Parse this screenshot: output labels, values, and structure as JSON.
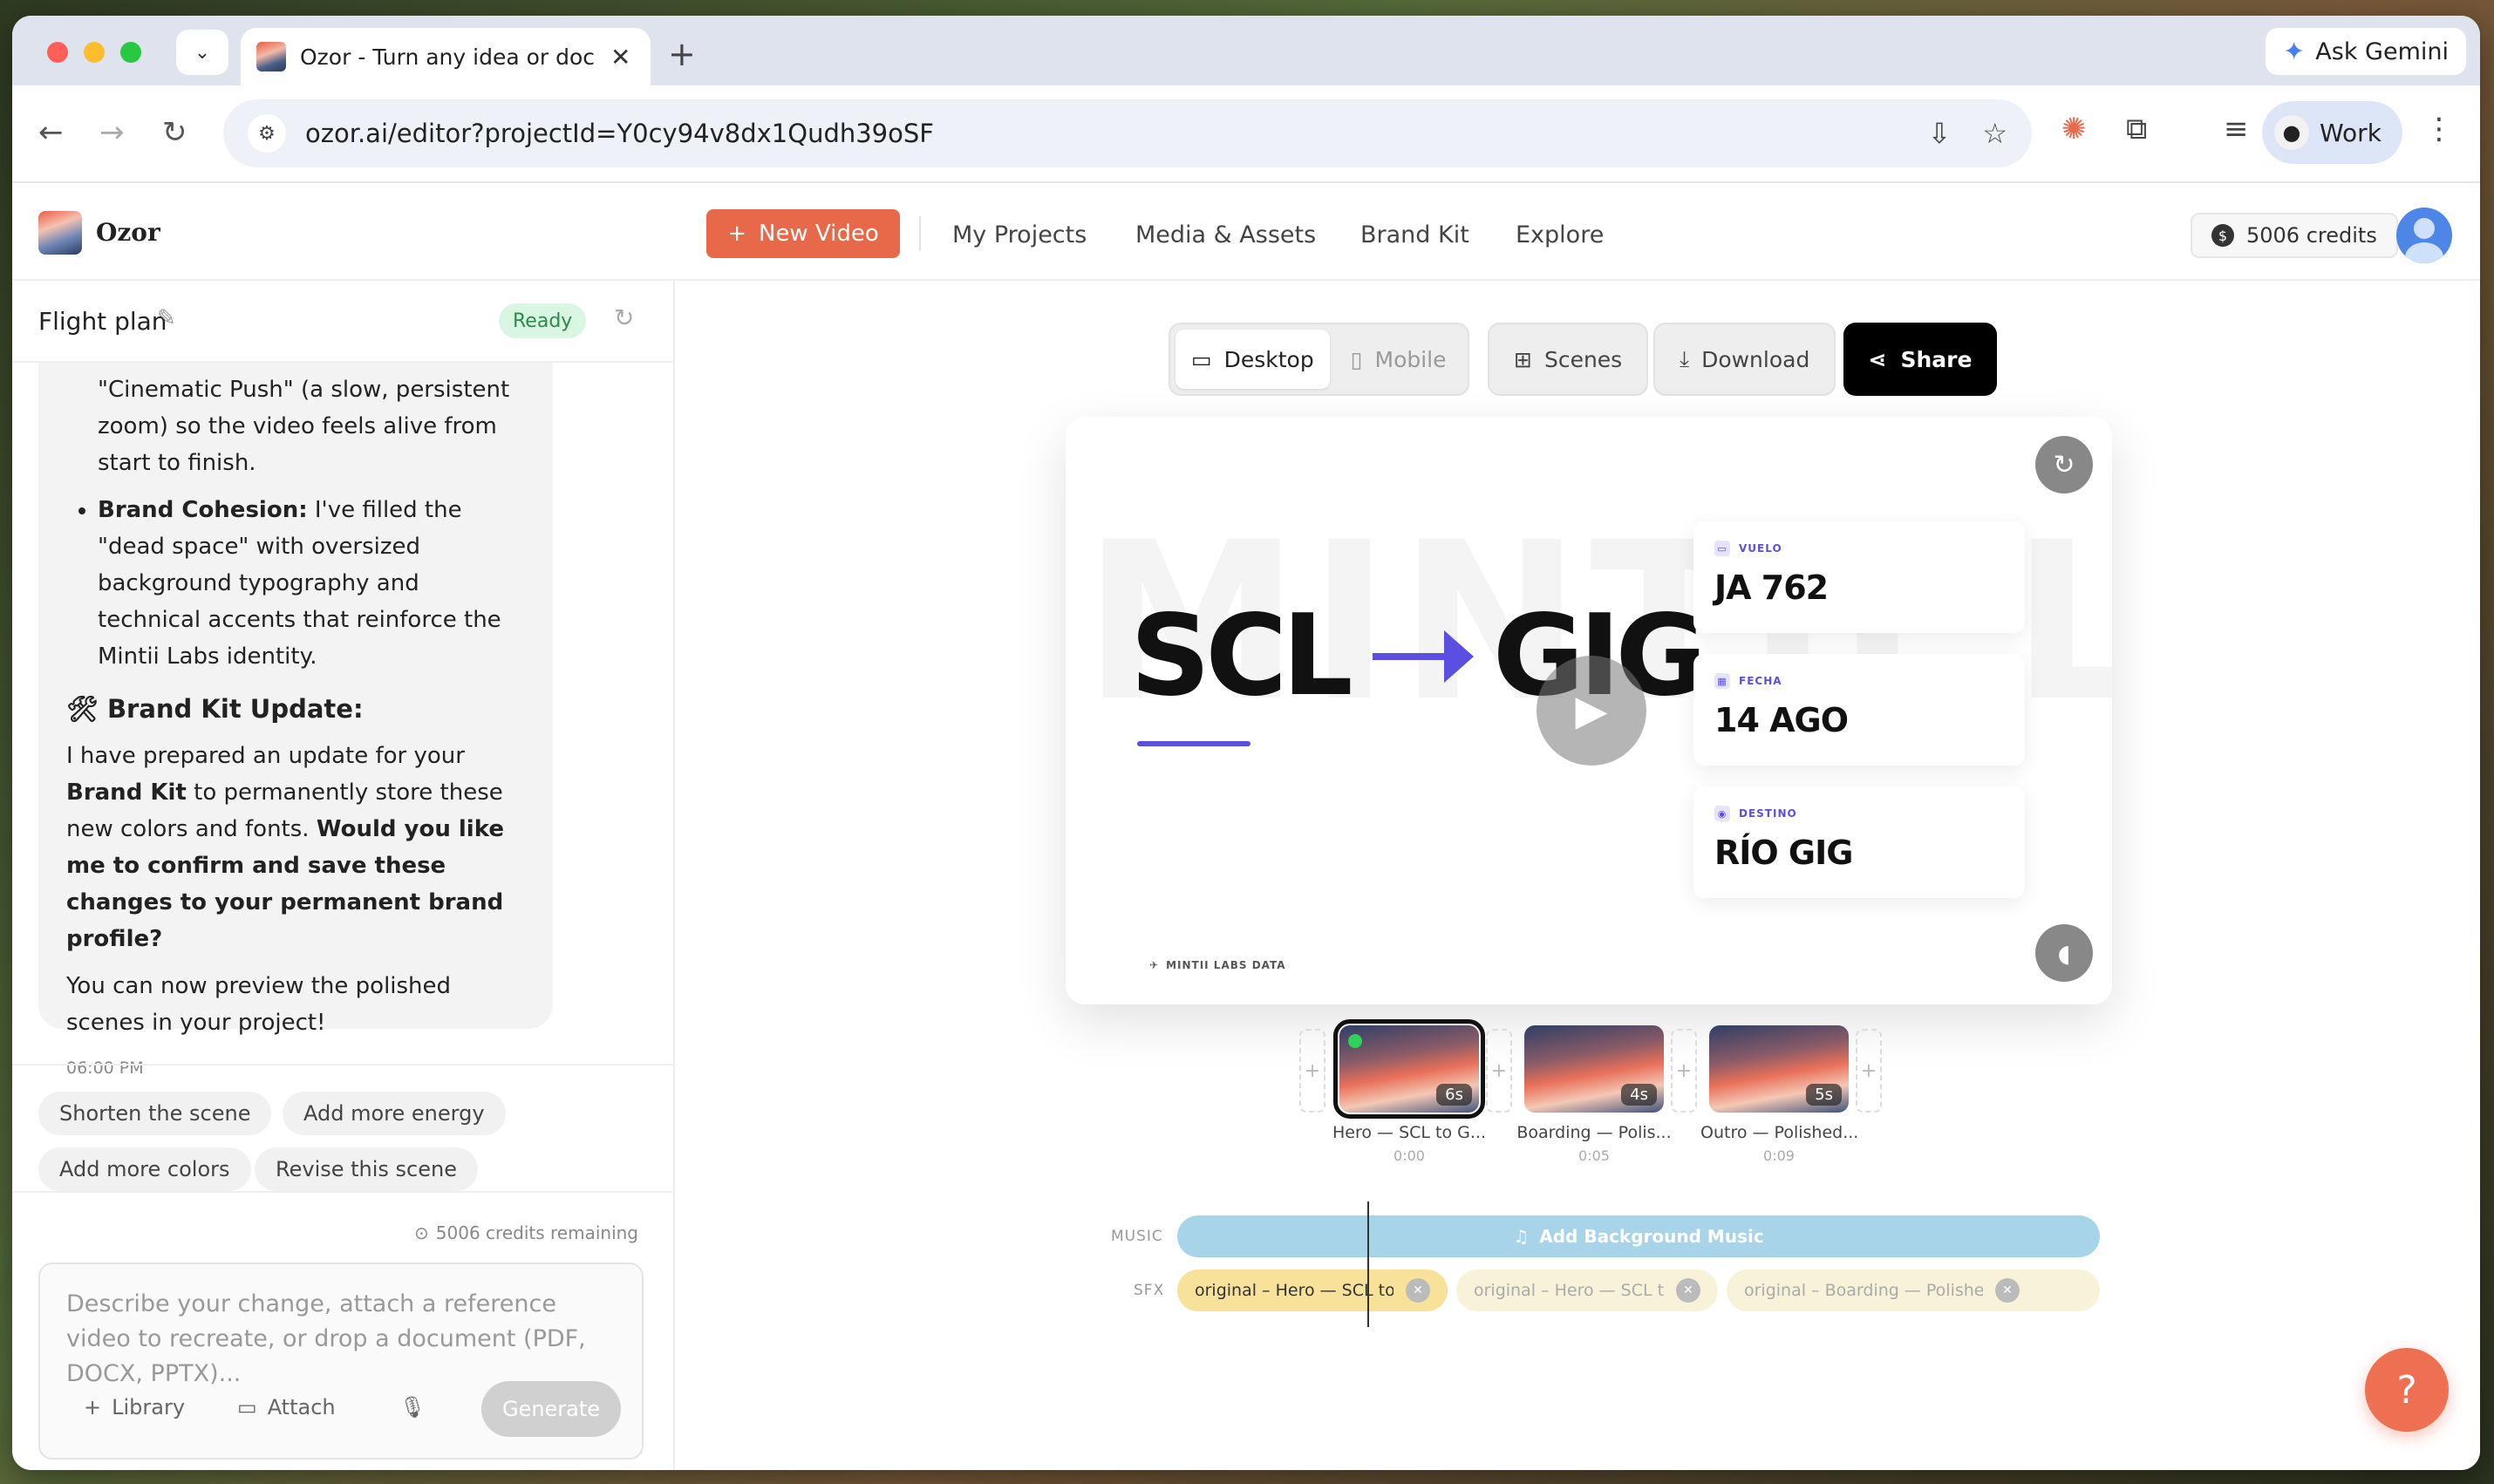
{
  "browser": {
    "tab_title": "Ozor - Turn any idea or docum",
    "url": "ozor.ai/editor?projectId=Y0cy94v8dx1Qudh39oSF",
    "ask_gemini": "Ask Gemini",
    "profile": "Work"
  },
  "header": {
    "brand": "Ozor",
    "new_video": "New Video",
    "nav": [
      "My Projects",
      "Media & Assets",
      "Brand Kit",
      "Explore"
    ],
    "credits": "5006 credits"
  },
  "chat": {
    "title": "Flight plan",
    "status": "Ready",
    "msg_cont": "\"Cinematic Push\" (a slow, persistent zoom) so the video feels alive from start to finish.",
    "bullet_bold": "Brand Cohesion:",
    "bullet_text": " I've filled the \"dead space\" with oversized background typography and technical accents that reinforce the Mintii Labs identity.",
    "section_icon": "🛠",
    "section_title": "Brand Kit Update:",
    "para1_a": "I have prepared an update for your ",
    "para1_b": "Brand Kit",
    "para1_c": " to permanently store these new colors and fonts. ",
    "para1_d": "Would you like me to confirm and save these changes to your permanent brand profile?",
    "para2": "You can now preview the polished scenes in your project!",
    "time": "06:00 PM",
    "suggestions": [
      "Shorten the scene",
      "Add more energy",
      "Add more colors",
      "Revise this scene"
    ],
    "credits_remaining": "5006 credits remaining",
    "composer_placeholder": "Describe your change, attach a reference video to recreate, or drop a document (PDF, DOCX, PPTX)...",
    "library": "Library",
    "attach": "Attach",
    "generate": "Generate"
  },
  "editor": {
    "desktop": "Desktop",
    "mobile": "Mobile",
    "scenes": "Scenes",
    "download": "Download",
    "share": "Share",
    "preview": {
      "watermark": "MINTII LAB",
      "from": "SCL",
      "to": "GIG",
      "cards": [
        {
          "label": "VUELO",
          "value": "JA 762"
        },
        {
          "label": "FECHA",
          "value": "14 AGO"
        },
        {
          "label": "DESTINO",
          "value": "RÍO GIG"
        }
      ],
      "footer": "MINTII LABS DATA"
    },
    "scenes_list": [
      {
        "name": "Hero — SCL to G...",
        "duration": "6s",
        "time": "0:00"
      },
      {
        "name": "Boarding — Polis...",
        "duration": "4s",
        "time": "0:05"
      },
      {
        "name": "Outro — Polished...",
        "duration": "5s",
        "time": "0:09"
      }
    ],
    "music_label": "MUSIC",
    "sfx_label": "SFX",
    "add_music": "Add Background Music",
    "sfx": [
      "original – Hero — SCL to GIG Polish...",
      "original – Hero — SCL to ...",
      "original – Boarding — Polished..."
    ]
  },
  "colors": {
    "accent": "#e8684a",
    "route": "#5a4fe0",
    "ready_bg": "#d9f6e2"
  }
}
